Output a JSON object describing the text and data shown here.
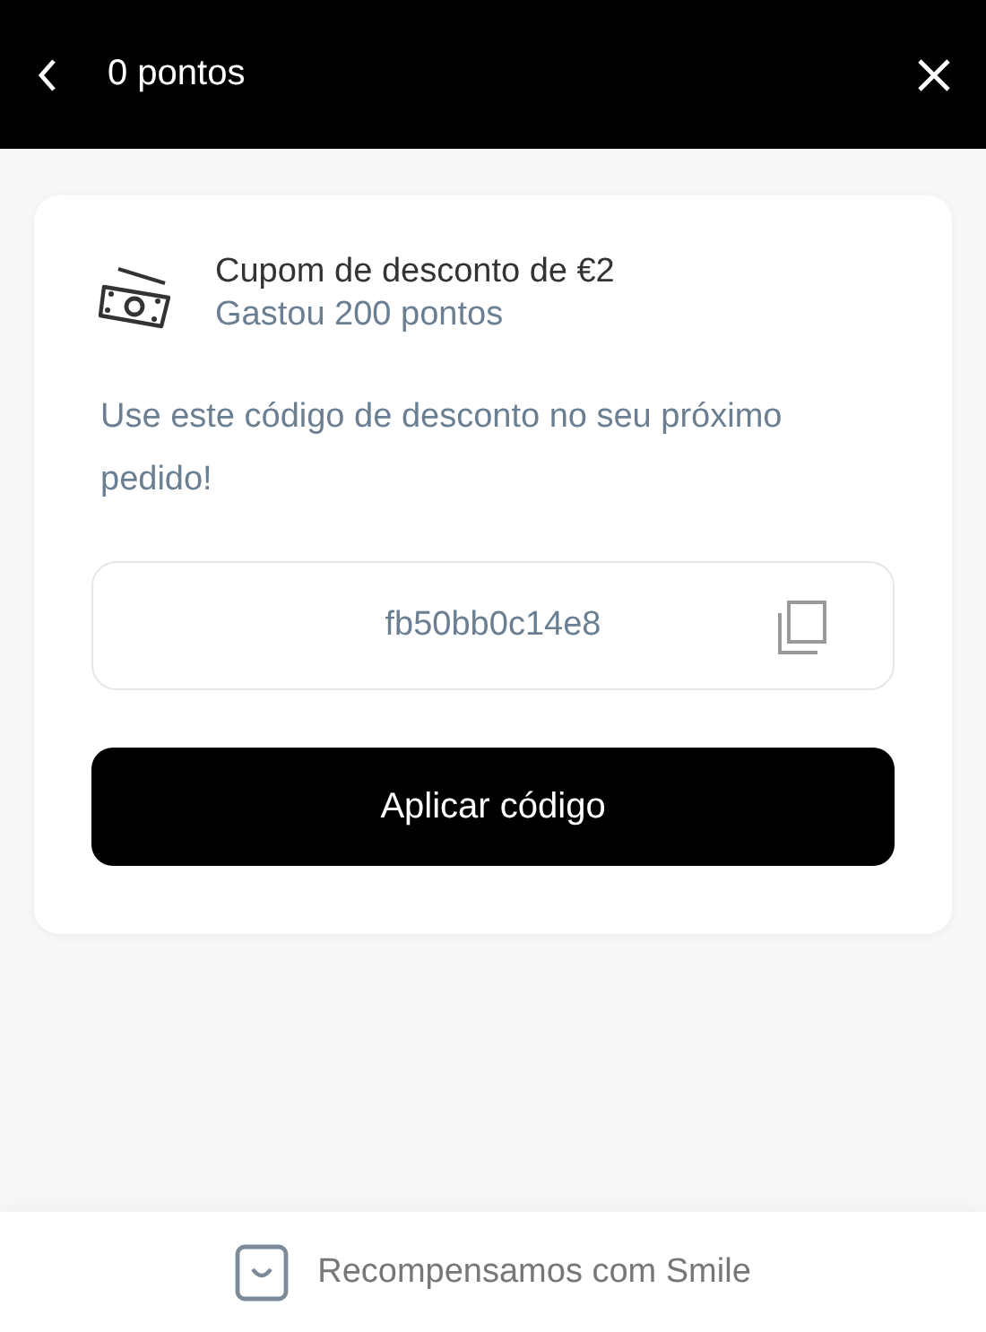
{
  "header": {
    "title": "0 pontos"
  },
  "reward": {
    "title": "Cupom de desconto de €2",
    "subtitle": "Gastou 200 pontos"
  },
  "instructions": "Use este código de desconto no seu próximo pedido!",
  "code": {
    "value": "fb50bb0c14e8"
  },
  "apply_button": "Aplicar código",
  "footer": "Recompensamos com Smile"
}
